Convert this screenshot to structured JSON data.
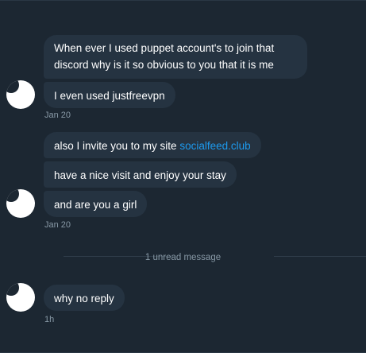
{
  "conversation": {
    "groups": [
      {
        "messages": [
          "When ever I used puppet account's to join that",
          "discord why is it so obvious to you that it is me",
          "I even used justfreevpn"
        ],
        "time": "Jan 20"
      },
      {
        "messages": [
          "also I invite you to my site ",
          "have a nice visit and enjoy your stay",
          "and are you a girl"
        ],
        "link": "socialfeed.club",
        "time": "Jan 20"
      },
      {
        "messages": [
          "why no reply"
        ],
        "time": "1h"
      }
    ],
    "unread_divider": "1 unread message"
  },
  "colors": {
    "background": "#1c2732",
    "bubble": "#253341",
    "link": "#1d9bf0",
    "muted_text": "#8899a6"
  }
}
